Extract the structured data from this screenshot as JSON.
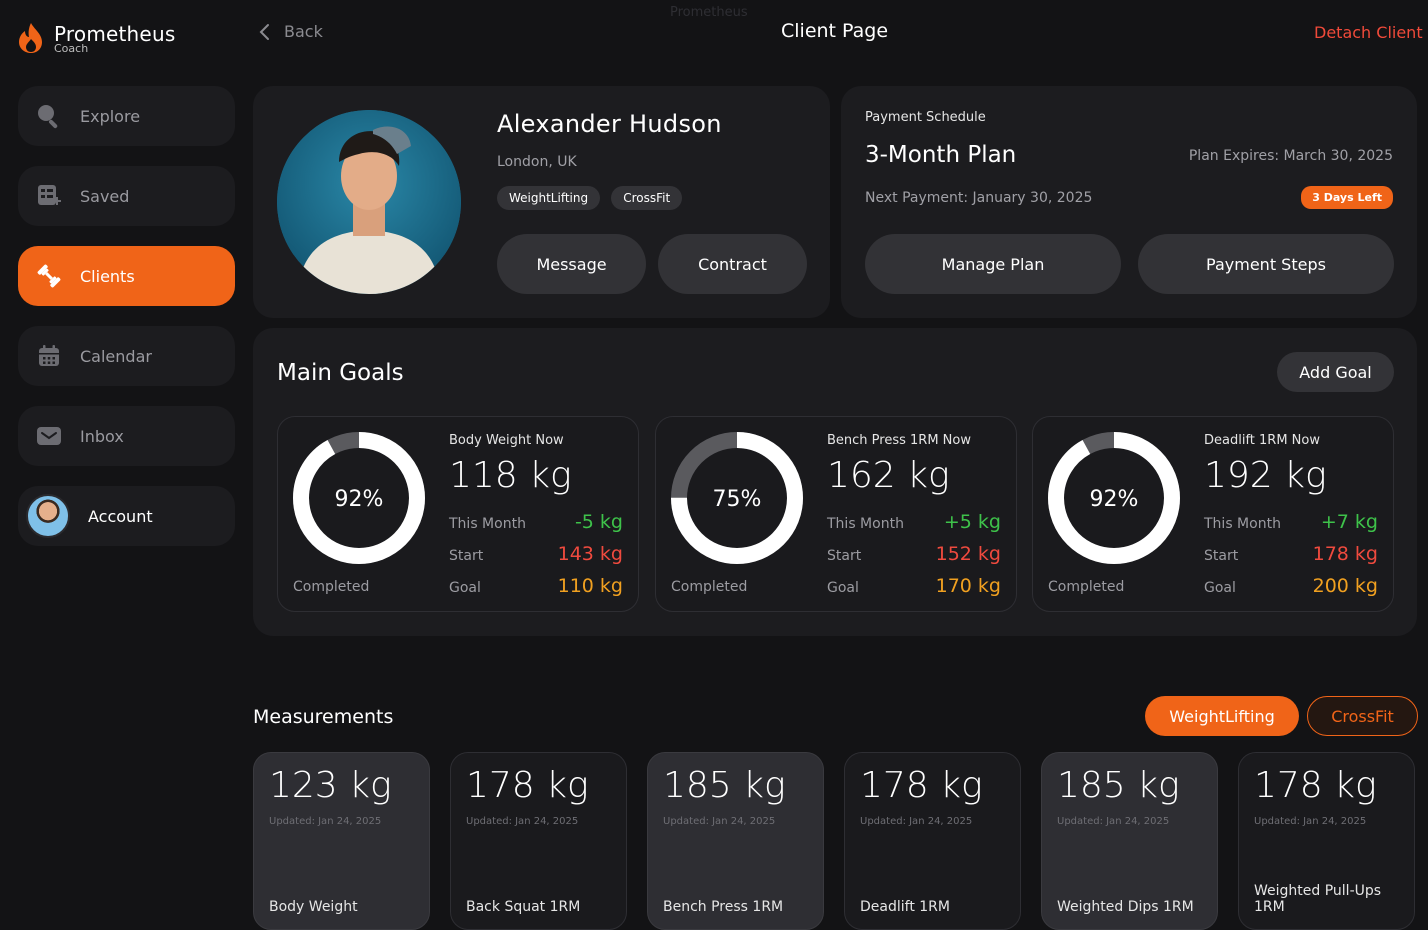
{
  "brand": {
    "name": "Prometheus",
    "sub": "Coach"
  },
  "sidebar": {
    "items": [
      {
        "label": "Explore",
        "icon": "search-icon"
      },
      {
        "label": "Saved",
        "icon": "saved-list-icon"
      },
      {
        "label": "Clients",
        "icon": "dumbbell-icon",
        "active": true
      },
      {
        "label": "Calendar",
        "icon": "calendar-icon"
      },
      {
        "label": "Inbox",
        "icon": "mail-icon"
      },
      {
        "label": "Account",
        "icon": "avatar"
      }
    ]
  },
  "header": {
    "back": "Back",
    "title": "Client Page",
    "ghost": "Prometheus",
    "detach": "Detach Client"
  },
  "client": {
    "name": "Alexander Hudson",
    "location": "London, UK",
    "tags": [
      "WeightLifting",
      "CrossFit"
    ],
    "message_btn": "Message",
    "contract_btn": "Contract"
  },
  "payment": {
    "heading": "Payment Schedule",
    "plan": "3-Month Plan",
    "expires": "Plan Expires: March 30, 2025",
    "next": "Next Payment: January 30, 2025",
    "badge": "3 Days Left",
    "manage_btn": "Manage Plan",
    "steps_btn": "Payment Steps"
  },
  "goals": {
    "title": "Main Goals",
    "add_btn": "Add Goal",
    "completed_label": "Completed",
    "this_month_label": "This Month",
    "start_label": "Start",
    "goal_label": "Goal",
    "items": [
      {
        "label": "Body Weight Now",
        "now": "118 kg",
        "percent_text": "92%",
        "percent": 0.92,
        "this_month": "-5 kg",
        "start": "143 kg",
        "goal": "110 kg"
      },
      {
        "label": "Bench Press 1RM Now",
        "now": "162 kg",
        "percent_text": "75%",
        "percent": 0.75,
        "this_month": "+5 kg",
        "start": "152 kg",
        "goal": "170 kg"
      },
      {
        "label": "Deadlift 1RM Now",
        "now": "192 kg",
        "percent_text": "92%",
        "percent": 0.92,
        "this_month": "+7 kg",
        "start": "178 kg",
        "goal": "200 kg"
      }
    ]
  },
  "measurements": {
    "title": "Measurements",
    "filters": [
      "WeightLifting",
      "CrossFit"
    ],
    "items": [
      {
        "value": "123 kg",
        "updated": "Updated: Jan 24, 2025",
        "name": "Body Weight"
      },
      {
        "value": "178 kg",
        "updated": "Updated: Jan 24, 2025",
        "name": "Back Squat 1RM"
      },
      {
        "value": "185 kg",
        "updated": "Updated: Jan 24, 2025",
        "name": "Bench Press 1RM"
      },
      {
        "value": "178 kg",
        "updated": "Updated: Jan 24, 2025",
        "name": "Deadlift 1RM"
      },
      {
        "value": "185 kg",
        "updated": "Updated: Jan 24, 2025",
        "name": "Weighted Dips 1RM"
      },
      {
        "value": "178 kg",
        "updated": "Updated: Jan 24, 2025",
        "name": "Weighted Pull-Ups 1RM"
      }
    ]
  },
  "colors": {
    "accent": "#f06418",
    "green": "#3ec24a",
    "red": "#ef4a3e",
    "orange": "#f0a020"
  }
}
